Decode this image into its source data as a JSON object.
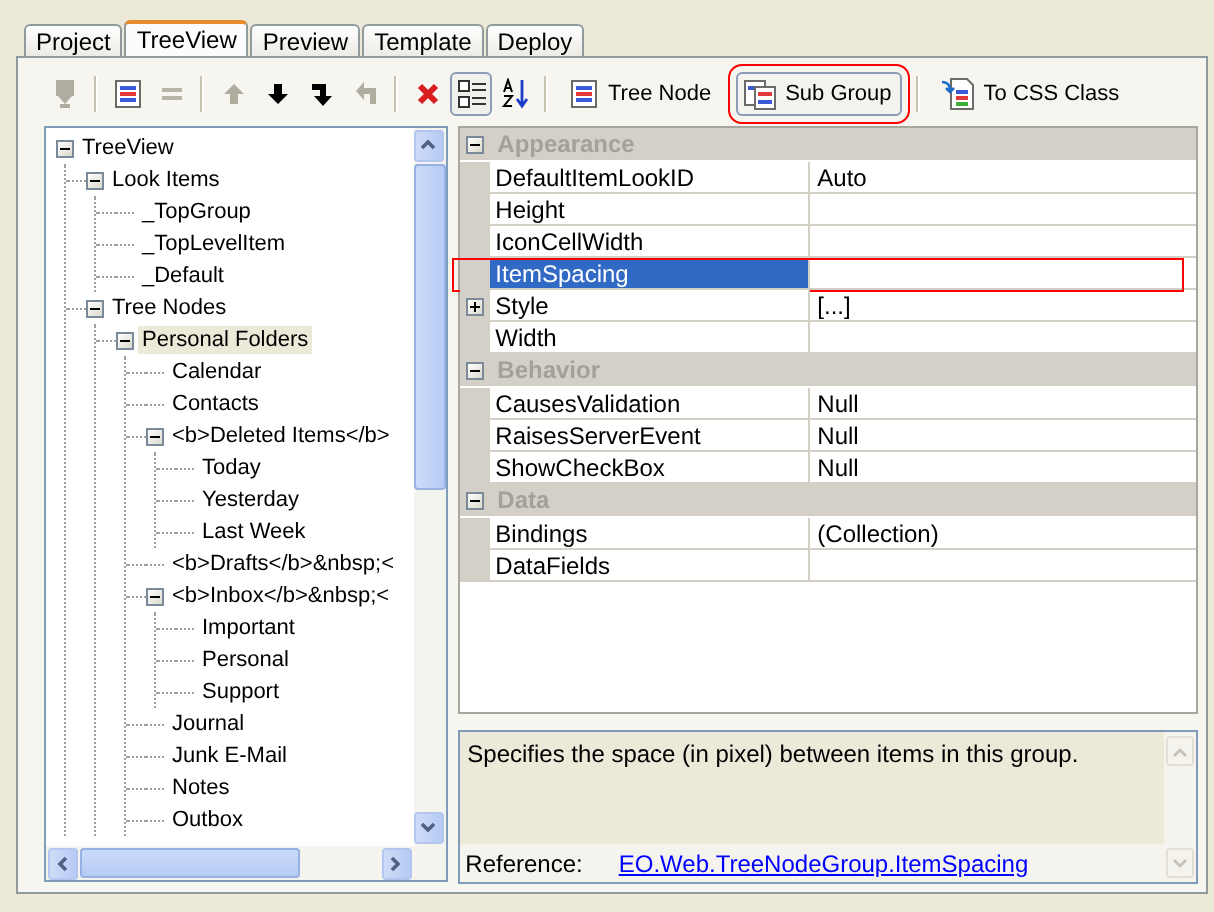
{
  "tabs": [
    {
      "label": "Project",
      "selected": false
    },
    {
      "label": "TreeView",
      "selected": true
    },
    {
      "label": "Preview",
      "selected": false
    },
    {
      "label": "Template",
      "selected": false
    },
    {
      "label": "Deploy",
      "selected": false
    }
  ],
  "toolbar": [
    {
      "kind": "icon",
      "disabled": true,
      "selected": false
    },
    {
      "kind": "separator"
    },
    {
      "kind": "icon",
      "disabled": false,
      "selected": false
    },
    {
      "kind": "icon",
      "disabled": true,
      "selected": false
    },
    {
      "kind": "separator"
    },
    {
      "kind": "icon",
      "disabled": true,
      "selected": false
    },
    {
      "kind": "icon",
      "disabled": false,
      "selected": false
    },
    {
      "kind": "icon",
      "disabled": false,
      "selected": false
    },
    {
      "kind": "icon",
      "disabled": true,
      "selected": false
    },
    {
      "kind": "separator"
    },
    {
      "kind": "icon",
      "disabled": false,
      "selected": false
    },
    {
      "kind": "icon",
      "disabled": false,
      "selected": true
    },
    {
      "kind": "icon",
      "disabled": false,
      "selected": false
    },
    {
      "kind": "separator"
    },
    {
      "kind": "text",
      "label": "Tree Node",
      "selected": false,
      "annotated": false
    },
    {
      "kind": "text",
      "label": "Sub Group",
      "selected": true,
      "annotated": true
    },
    {
      "kind": "separator"
    },
    {
      "kind": "text",
      "label": "To CSS Class",
      "selected": false,
      "annotated": false
    }
  ],
  "tree": [
    {
      "label": "TreeView",
      "selected": false,
      "expanded": true,
      "children": [
        {
          "label": "Look Items",
          "selected": false,
          "expanded": true,
          "children": [
            {
              "label": "_TopGroup",
              "selected": false
            },
            {
              "label": "_TopLevelItem",
              "selected": false
            },
            {
              "label": "_Default",
              "selected": false
            }
          ]
        },
        {
          "label": "Tree Nodes",
          "selected": false,
          "expanded": true,
          "children": [
            {
              "label": "Personal Folders",
              "selected": true,
              "expanded": true,
              "children": [
                {
                  "label": "Calendar",
                  "selected": false
                },
                {
                  "label": "Contacts",
                  "selected": false
                },
                {
                  "label": "<b>Deleted Items</b>",
                  "selected": false,
                  "expanded": true,
                  "children": [
                    {
                      "label": "Today",
                      "selected": false
                    },
                    {
                      "label": "Yesterday",
                      "selected": false
                    },
                    {
                      "label": "Last Week",
                      "selected": false
                    }
                  ]
                },
                {
                  "label": "<b>Drafts</b>&nbsp;<",
                  "selected": false
                },
                {
                  "label": "<b>Inbox</b>&nbsp;<",
                  "selected": false,
                  "expanded": true,
                  "children": [
                    {
                      "label": "Important",
                      "selected": false
                    },
                    {
                      "label": "Personal",
                      "selected": false
                    },
                    {
                      "label": "Support",
                      "selected": false
                    }
                  ]
                },
                {
                  "label": "Journal",
                  "selected": false
                },
                {
                  "label": "Junk E-Mail",
                  "selected": false
                },
                {
                  "label": "Notes",
                  "selected": false
                },
                {
                  "label": "Outbox",
                  "selected": false
                }
              ]
            }
          ]
        }
      ]
    }
  ],
  "properties": [
    {
      "category": "Appearance",
      "expanded": true,
      "rows": [
        {
          "name": "DefaultItemLookID",
          "value": "Auto",
          "selected": false
        },
        {
          "name": "Height",
          "selected": false
        },
        {
          "name": "IconCellWidth",
          "selected": false
        },
        {
          "name": "ItemSpacing",
          "selected": true,
          "annotated": true
        },
        {
          "name": "Style",
          "value": "[...]",
          "selected": false,
          "expanded": false
        },
        {
          "name": "Width",
          "selected": false
        }
      ]
    },
    {
      "category": "Behavior",
      "expanded": true,
      "rows": [
        {
          "name": "CausesValidation",
          "value": "Null",
          "selected": false
        },
        {
          "name": "RaisesServerEvent",
          "value": "Null",
          "selected": false
        },
        {
          "name": "ShowCheckBox",
          "value": "Null",
          "selected": false
        }
      ]
    },
    {
      "category": "Data",
      "expanded": true,
      "rows": [
        {
          "name": "Bindings",
          "value": "(Collection)",
          "selected": false
        },
        {
          "name": "DataFields",
          "selected": false
        }
      ]
    }
  ],
  "description": {
    "text": "Specifies the space (in pixel) between items in this group.",
    "reference_label": "Reference:",
    "reference_link": "EO.Web.TreeNodeGroup.ItemSpacing"
  }
}
